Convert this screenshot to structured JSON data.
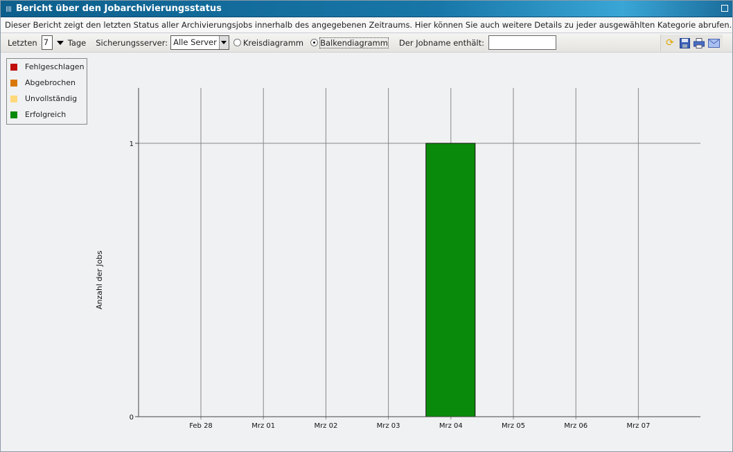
{
  "window": {
    "title": "Bericht über den Jobarchivierungsstatus"
  },
  "description": "Dieser Bericht zeigt den letzten Status aller Archivierungsjobs innerhalb des angegebenen Zeitraums. Hier können Sie auch weitere Details zu jeder ausgewählten Kategorie abrufen.",
  "toolbar": {
    "last_label": "Letzten",
    "days_value": "7",
    "days_label": "Tage",
    "server_label": "Sicherungsserver:",
    "server_value": "Alle Server",
    "pie_label": "Kreisdiagramm",
    "bar_label": "Balkendiagramm",
    "selected_chart": "bar",
    "jobname_label": "Der Jobname enthält:",
    "jobname_value": "",
    "icons": [
      "refresh-icon",
      "save-icon",
      "print-icon",
      "email-icon"
    ]
  },
  "legend": [
    {
      "label": "Fehlgeschlagen",
      "color": "#c00d0d"
    },
    {
      "label": "Abgebrochen",
      "color": "#d97706"
    },
    {
      "label": "Unvollständig",
      "color": "#ffd97a"
    },
    {
      "label": "Erfolgreich",
      "color": "#0a8a0a"
    }
  ],
  "chart_data": {
    "type": "bar",
    "ylabel": "Anzahl der Jobs",
    "xlabel": "",
    "categories": [
      "Feb 28",
      "Mrz 01",
      "Mrz 02",
      "Mrz 03",
      "Mrz 04",
      "Mrz 05",
      "Mrz 06",
      "Mrz 07"
    ],
    "series": [
      {
        "name": "Erfolgreich",
        "color": "#0a8a0a",
        "values": [
          0,
          0,
          0,
          0,
          1,
          0,
          0,
          0
        ]
      }
    ],
    "yticks": [
      "0",
      "1"
    ],
    "ylim": [
      0,
      1.2
    ],
    "grid": true
  }
}
